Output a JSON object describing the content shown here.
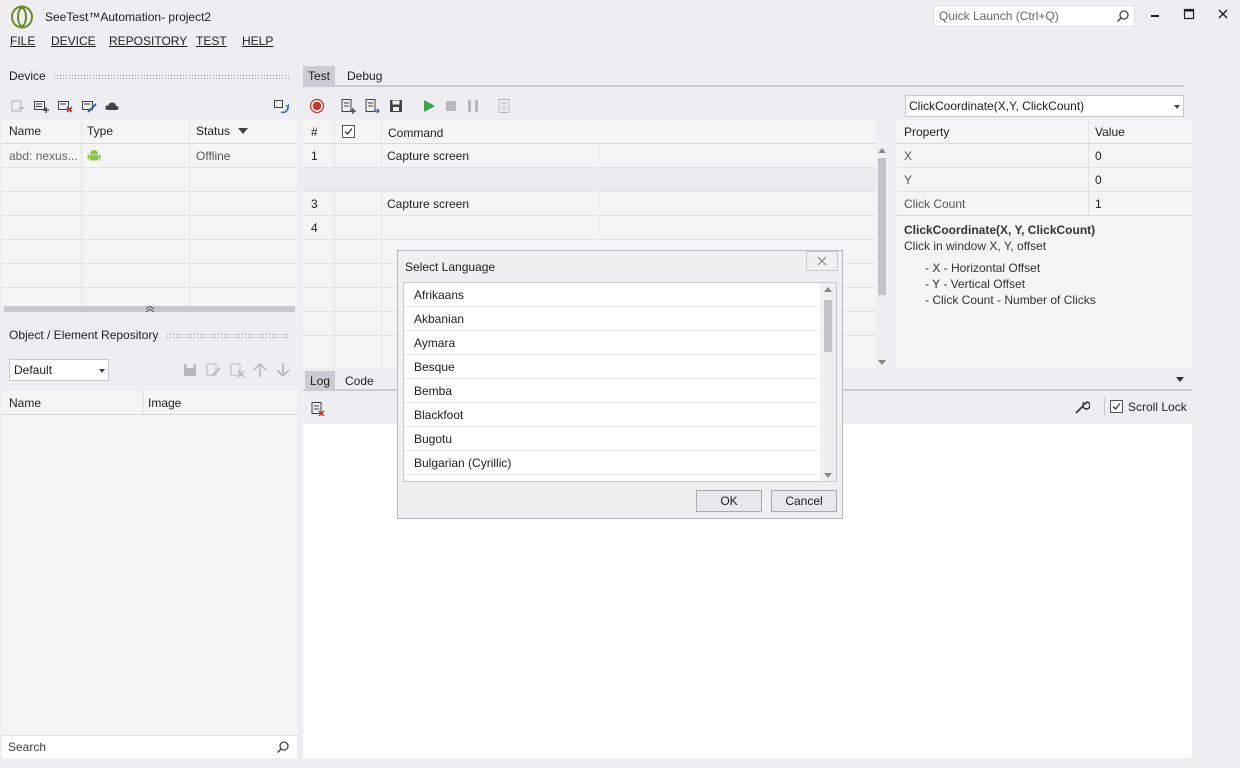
{
  "window": {
    "title": "SeeTest™Automation- project2",
    "quick_launch_placeholder": "Quick Launch (Ctrl+Q)"
  },
  "menu": [
    "FILE",
    "DEVICE",
    "REPOSITORY",
    "TEST",
    "HELP"
  ],
  "device_panel": {
    "title": "Device",
    "columns": [
      "Name",
      "Type",
      "Status"
    ],
    "rows": [
      {
        "name": "abd: nexus...",
        "type_icon": "android-icon",
        "status": "Offline"
      }
    ]
  },
  "repo_panel": {
    "title": "Object / Element Repository",
    "dropdown_value": "Default",
    "columns": [
      "Name",
      "Image"
    ],
    "search_placeholder": "Search"
  },
  "test_tabs": [
    "Test",
    "Debug"
  ],
  "commands": {
    "columns": [
      "#",
      "Command"
    ],
    "rows": [
      {
        "num": "1",
        "command": "Capture screen"
      },
      {
        "num": "",
        "command": ""
      },
      {
        "num": "3",
        "command": "Capture screen"
      },
      {
        "num": "4",
        "command": ""
      }
    ]
  },
  "properties": {
    "selected_command": "ClickCoordinate(X,Y, ClickCount)",
    "columns": [
      "Property",
      "Value"
    ],
    "rows": [
      {
        "property": "X",
        "value": "0"
      },
      {
        "property": "Y",
        "value": "0"
      },
      {
        "property": "Click Count",
        "value": "1"
      }
    ],
    "help_title": "ClickCoordinate(X, Y, ClickCount)",
    "help_desc": "Click in window X, Y, offset",
    "help_items": [
      "- X - Horizontal Offset",
      "- Y - Vertical Offset",
      "- Click Count - Number of Clicks"
    ]
  },
  "log_tabs": [
    "Log",
    "Code"
  ],
  "log_toolbar": {
    "scroll_lock_label": "Scroll Lock"
  },
  "dialog": {
    "title": "Select Language",
    "languages": [
      "Afrikaans",
      "Akbanian",
      "Aymara",
      "Besque",
      "Bemba",
      "Blackfoot",
      "Bugotu",
      "Bulgarian (Cyrillic)"
    ],
    "ok_label": "OK",
    "cancel_label": "Cancel"
  },
  "colors": {
    "background": "#eeeef2",
    "accent_green": "#3ea24a",
    "record_red": "#c0392b",
    "android_green": "#8ac541"
  }
}
